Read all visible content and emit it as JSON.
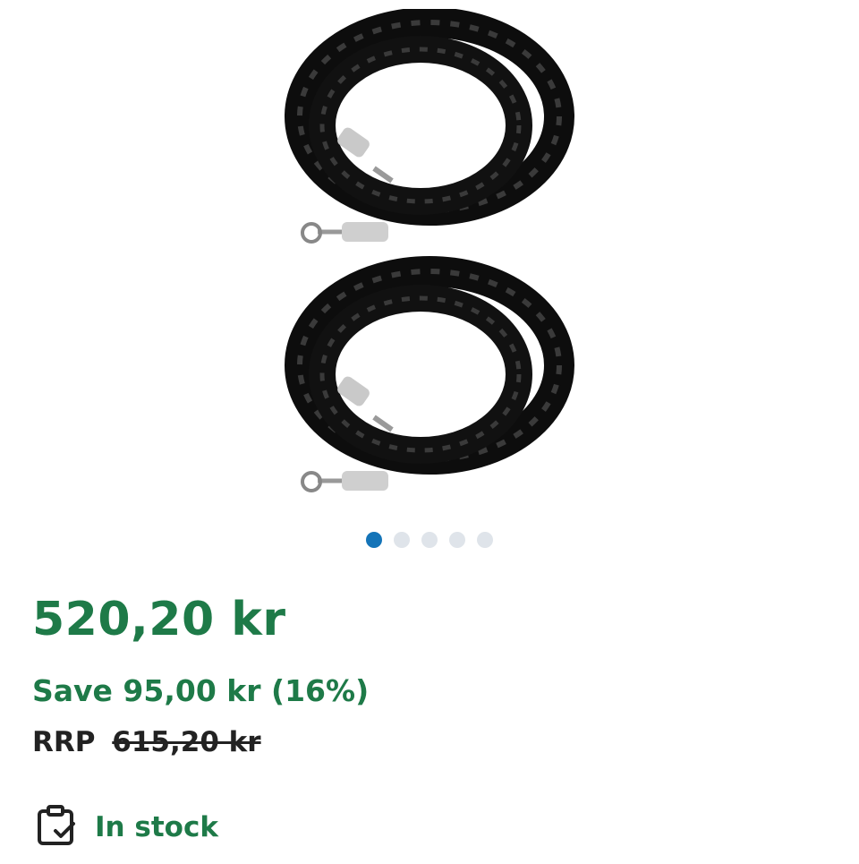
{
  "gallery": {
    "image_alt": "Two black twisted barrier ropes with silver hooks",
    "slide_count": 5,
    "active_slide": 1
  },
  "pricing": {
    "current_price": "520,20 kr",
    "savings": "Save 95,00 kr (16%)",
    "rrp_label": "RRP",
    "rrp_price": "615,20 kr"
  },
  "availability": {
    "status": "In stock",
    "icon": "clipboard-check-icon"
  },
  "colors": {
    "price_green": "#1e7a48",
    "dot_active": "#1474b8",
    "dot_inactive": "#dfe4ea"
  }
}
